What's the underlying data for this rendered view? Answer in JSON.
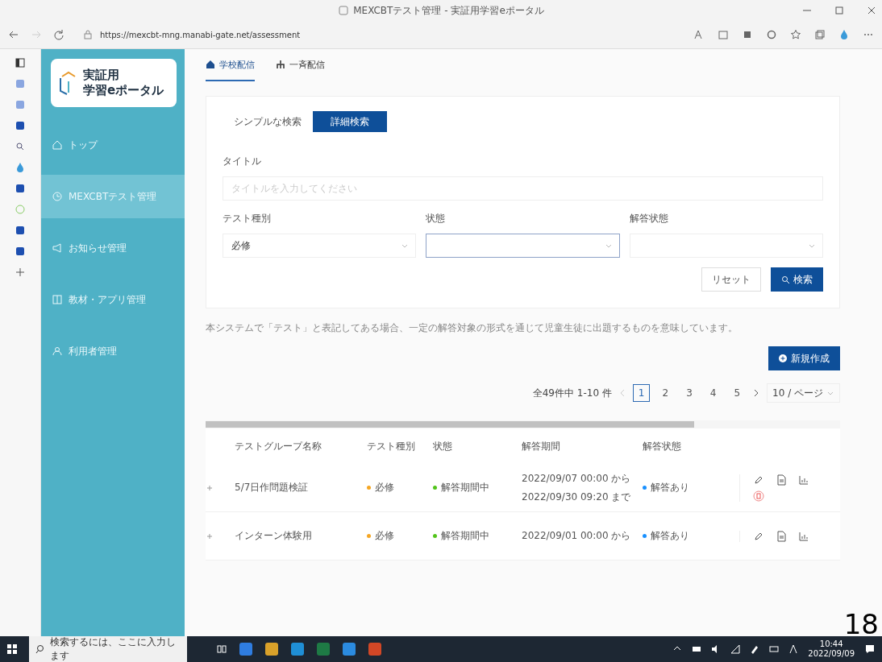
{
  "window": {
    "title": "MEXCBTテスト管理 - 実証用学習eポータル"
  },
  "browser": {
    "url": "https://mexcbt-mng.manabi-gate.net/assessment"
  },
  "sidebar": {
    "logo_lines": [
      "実証用",
      "学習eポータル"
    ],
    "items": [
      {
        "label": "トップ",
        "selected": false
      },
      {
        "label": "MEXCBTテスト管理",
        "selected": true
      },
      {
        "label": "お知らせ管理",
        "selected": false
      },
      {
        "label": "教材・アプリ管理",
        "selected": false
      },
      {
        "label": "利用者管理",
        "selected": false
      }
    ]
  },
  "tabs": [
    {
      "label": "学校配信",
      "selected": true
    },
    {
      "label": "一斉配信",
      "selected": false
    }
  ],
  "search": {
    "modes": [
      {
        "label": "シンプルな検索",
        "selected": false
      },
      {
        "label": "詳細検索",
        "selected": true
      }
    ],
    "fields": [
      {
        "label": "タイトル",
        "kind": "text",
        "placeholder": "タイトルを入力してください"
      },
      {
        "label": "テスト種別",
        "kind": "select",
        "value": "必修",
        "focused": false
      },
      {
        "label": "状態",
        "kind": "select",
        "focused": true
      },
      {
        "label": "解答状態",
        "kind": "select",
        "focused": false
      }
    ],
    "buttons": [
      {
        "label": "リセット",
        "kind": "secondary"
      },
      {
        "label": "検索",
        "kind": "primary"
      }
    ]
  },
  "note": "本システムで「テスト」と表記してある場合、一定の解答対象の形式を通じて児童生徒に出題するものを意味しています。",
  "new_button": "新規作成",
  "pagination": {
    "summary": "全49件中 1-10 件",
    "pages": [
      {
        "label": "1",
        "selected": true
      },
      {
        "label": "2",
        "selected": false
      },
      {
        "label": "3",
        "selected": false
      },
      {
        "label": "4",
        "selected": false
      },
      {
        "label": "5",
        "selected": false
      }
    ],
    "page_size": "10 / ページ"
  },
  "table": {
    "columns": [
      "テストグループ名称",
      "テスト種別",
      "状態",
      "解答期間",
      "解答状態"
    ],
    "rows": [
      {
        "name": "5/7日作問題検証",
        "type": {
          "text": "必修",
          "color": "#f5a623"
        },
        "status": {
          "text": "解答期間中",
          "color": "#52c41a"
        },
        "period": [
          "2022/09/07 00:00 から",
          "2022/09/30 09:20 まで"
        ],
        "answer_state": {
          "text": "解答あり",
          "color": "#1890ff"
        },
        "deletable": true
      },
      {
        "name": "インターン体験用",
        "type": {
          "text": "必修",
          "color": "#f5a623"
        },
        "status": {
          "text": "解答期間中",
          "color": "#52c41a"
        },
        "period": [
          "2022/09/01 00:00 から"
        ],
        "answer_state": {
          "text": "解答あり",
          "color": "#1890ff"
        },
        "deletable": false
      }
    ]
  },
  "taskbar": {
    "search_placeholder": "検索するには、ここに入力します",
    "time": "10:44",
    "date": "2022/09/09"
  },
  "page_number": "18"
}
